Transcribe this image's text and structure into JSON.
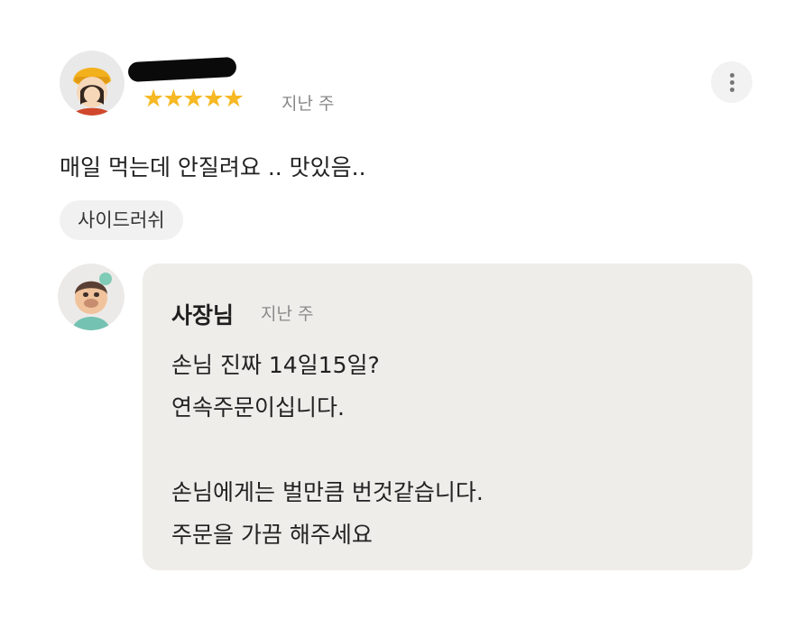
{
  "review": {
    "stars": "★★★★★",
    "time": "지난 주",
    "text": "매일 먹는데 안질려요 .. 맛있음..",
    "menu_tag": "사이드러쉬"
  },
  "reply": {
    "author": "사장님",
    "time": "지난 주",
    "lines": [
      "손님 진짜 14일15일?",
      "연속주문이십니다.",
      "",
      "손님에게는 벌만큼 번것같습니다.",
      "주문을 가끔 해주세요"
    ]
  },
  "colors": {
    "star": "#f6b823",
    "reply_background": "#efedea",
    "tag_background": "#f1f1f1"
  },
  "icons": {
    "more": "more-vertical-icon",
    "reviewer_avatar": "reviewer-avatar",
    "owner_avatar": "owner-avatar"
  }
}
